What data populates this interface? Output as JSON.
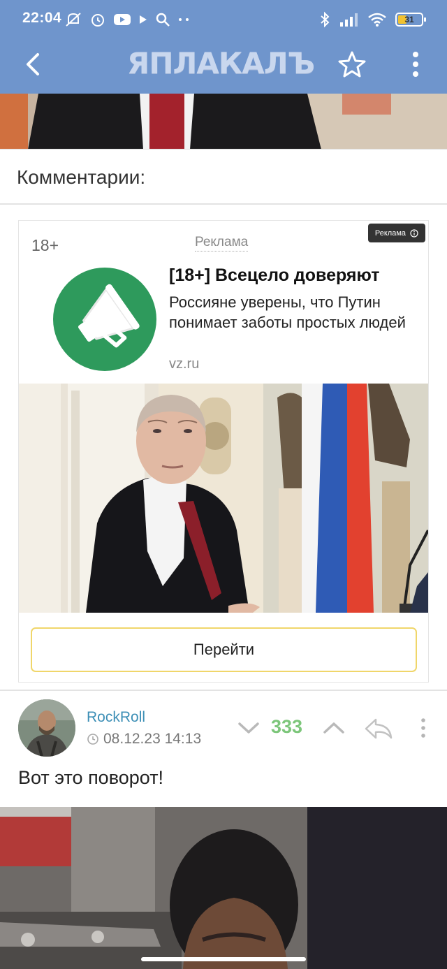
{
  "status": {
    "time": "22:04",
    "battery": "31"
  },
  "header": {
    "logo": "ЯПЛАКАЛЪ",
    "back_icon": "back-arrow-icon",
    "favorite_icon": "star-icon",
    "menu_icon": "more-vertical-icon"
  },
  "comments_title": "Комментарии:",
  "ad": {
    "age": "18+",
    "label": "Реклама",
    "badge": "Реклама",
    "headline": "[18+] Всецело доверяют",
    "body": "Россияне уверены, что Путин понимает заботы простых людей",
    "domain": "vz.ru",
    "cta": "Перейти",
    "logo_color": "#2e9a5c"
  },
  "comment": {
    "author": "RockRoll",
    "date": "08.12.23 14:13",
    "score": "333",
    "text": "Вот это поворот!",
    "score_color": "#7cc67a"
  },
  "colors": {
    "header_bg": "#6f95cc",
    "link": "#3d8fb6",
    "cta_border": "#f0d66a"
  }
}
